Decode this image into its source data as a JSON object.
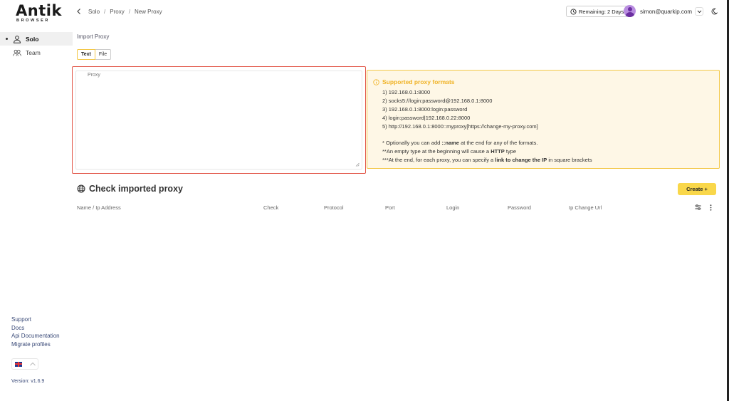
{
  "logo": {
    "main": "Antik",
    "sub": "BROWSER"
  },
  "nav": {
    "items": [
      {
        "label": "Solo"
      },
      {
        "label": "Team"
      }
    ]
  },
  "footer_links": [
    "Support",
    "Docs",
    "Api Documentation",
    "Migrate profiles"
  ],
  "version": "Version: v1.6.9",
  "breadcrumbs": [
    "Solo",
    "Proxy",
    "New Proxy"
  ],
  "header": {
    "remaining": "Remaining: 2 Days",
    "email": "simon@quarkip.com"
  },
  "import": {
    "title": "Import Proxy",
    "tabs": [
      "Text",
      "File"
    ],
    "proxy_label": "Proxy"
  },
  "info": {
    "title": "Supported proxy formats",
    "formats": [
      "1) 192.168.0.1:8000",
      "2) socks5://login:password@192.168.0.1:8000",
      "3) 192.168.0.1:8000:login:password",
      "4) login:password|192.168.0.22:8000",
      "5) http://192.168.0.1:8000::myproxy[https://change-my-proxy.com]"
    ],
    "note1": {
      "pre": "* Optionally you can add ",
      "bold": "::name",
      "post": " at the end for any of the formats."
    },
    "note2": {
      "pre": "**An empty type at the beginning will cause a ",
      "bold": "HTTP",
      "post": " type"
    },
    "note3": {
      "pre": "***At the end, for each proxy, you can specify a ",
      "bold": "link to change the IP",
      "post": " in square brackets"
    }
  },
  "check": {
    "title": "Check imported proxy",
    "create_label": "Create +",
    "columns": [
      "Name / Ip Address",
      "Check",
      "Protocol",
      "Port",
      "Login",
      "Password",
      "Ip Change Url"
    ]
  },
  "colors": {
    "accent": "#f9d74a",
    "info_bg": "#fef7e6",
    "info_border": "#f3c84a",
    "error_border": "#e2584a",
    "link": "#3a4a78"
  }
}
